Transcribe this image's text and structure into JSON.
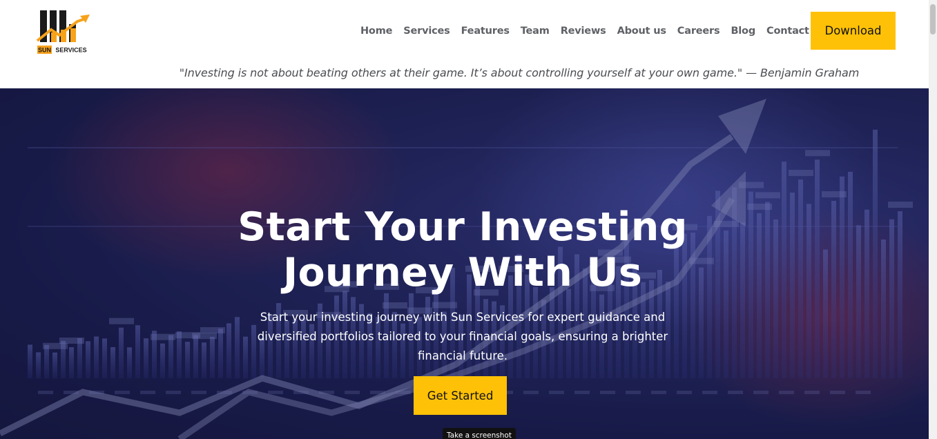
{
  "brand": {
    "logo_text_left": "SUN",
    "logo_text_right": "SERVICES",
    "colors": {
      "accent": "#ffc107",
      "logo_orange": "#f7a21b",
      "logo_dark": "#1b1b1b"
    }
  },
  "nav": {
    "items": [
      {
        "label": "Home"
      },
      {
        "label": "Services"
      },
      {
        "label": "Features"
      },
      {
        "label": "Team"
      },
      {
        "label": "Reviews"
      },
      {
        "label": "About us"
      },
      {
        "label": "Careers"
      },
      {
        "label": "Blog"
      },
      {
        "label": "Contact us"
      }
    ],
    "download_label": "Download"
  },
  "quote": "\"Investing is not about beating others at their game. It’s about controlling yourself at your own game.\" — Benjamin Graham",
  "hero": {
    "title_line1": "Start Your Investing",
    "title_line2": "Journey With Us",
    "text": "Start your investing journey with Sun Services for expert guidance and diversified portfolios tailored to your financial goals, ensuring a brighter financial future.",
    "cta_label": "Get Started",
    "background_icon": "stock-chart-arrow-background"
  },
  "tooltip": "Take a screenshot"
}
